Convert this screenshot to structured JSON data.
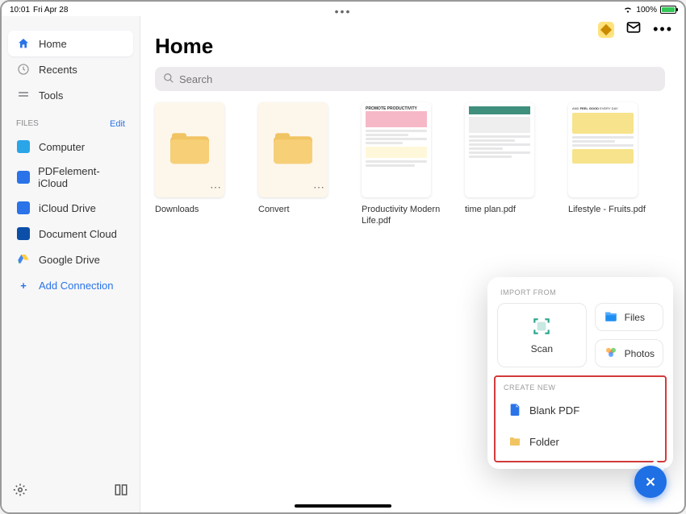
{
  "status": {
    "time": "10:01",
    "date": "Fri Apr 28",
    "battery_pct": "100%"
  },
  "header": {
    "premium_icon": "diamond-icon",
    "mail_icon": "mail-icon",
    "more_icon": "more-icon"
  },
  "sidebar": {
    "nav": [
      {
        "label": "Home",
        "icon": "home-icon"
      },
      {
        "label": "Recents",
        "icon": "clock-icon"
      },
      {
        "label": "Tools",
        "icon": "tools-icon"
      }
    ],
    "files_header": "FILES",
    "files_edit": "Edit",
    "locations": [
      {
        "label": "Computer",
        "icon": "monitor-icon"
      },
      {
        "label": "PDFelement-iCloud",
        "icon": "folder-blue-icon"
      },
      {
        "label": "iCloud Drive",
        "icon": "cloud-drive-icon"
      },
      {
        "label": "Document Cloud",
        "icon": "doc-cloud-icon"
      },
      {
        "label": "Google Drive",
        "icon": "google-drive-icon"
      }
    ],
    "add_connection": "Add Connection"
  },
  "main": {
    "title": "Home",
    "search_placeholder": "Search",
    "items": [
      {
        "type": "folder",
        "label": "Downloads"
      },
      {
        "type": "folder",
        "label": "Convert"
      },
      {
        "type": "doc",
        "label": "Productivity Modern Life.pdf",
        "thumb": "pink"
      },
      {
        "type": "doc",
        "label": "time plan.pdf",
        "thumb": "green"
      },
      {
        "type": "doc",
        "label": "Lifestyle - Fruits.pdf",
        "thumb": "lemon"
      }
    ]
  },
  "popup": {
    "import_header": "IMPORT FROM",
    "scan": "Scan",
    "files": "Files",
    "photos": "Photos",
    "create_header": "CREATE NEW",
    "blank_pdf": "Blank PDF",
    "folder": "Folder"
  }
}
